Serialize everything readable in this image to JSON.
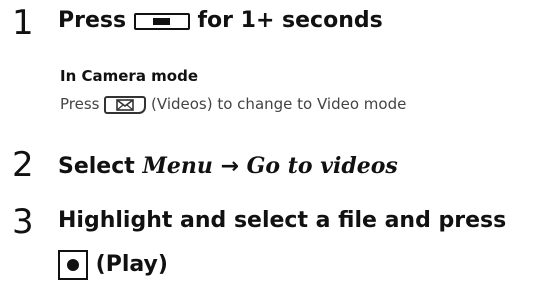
{
  "step1": {
    "number": "1",
    "prefix": "Press",
    "suffix": "for 1+ seconds",
    "sub_heading": "In Camera mode",
    "sub_prefix": "Press",
    "sub_suffix": "(Videos) to change to Video mode"
  },
  "step2": {
    "number": "2",
    "prefix": "Select",
    "menu": "Menu",
    "arrow": "→",
    "target": "Go to videos"
  },
  "step3": {
    "number": "3",
    "line1": "Highlight and select a file and press",
    "line2": "(Play)"
  },
  "icons": {
    "long_key": "end-key-icon",
    "mail_key": "mail-key-icon",
    "center_key": "center-select-key-icon"
  }
}
